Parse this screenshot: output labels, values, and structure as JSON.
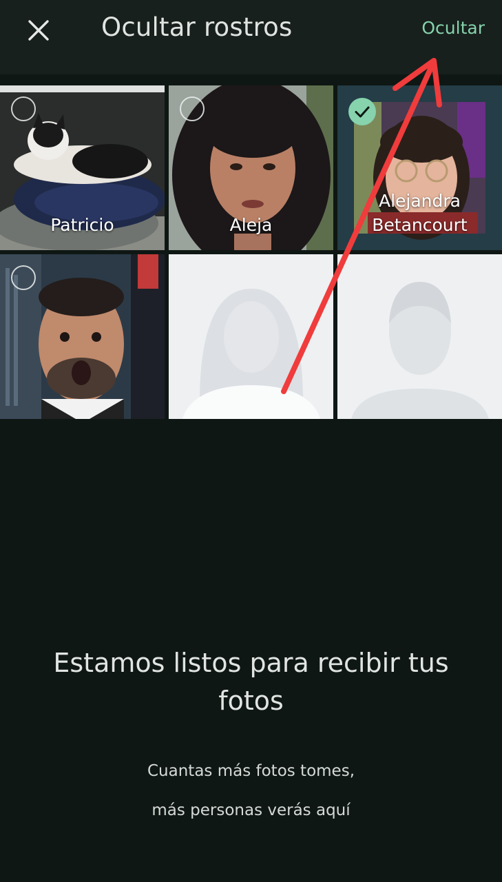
{
  "header": {
    "title": "Ocultar rostros",
    "action_label": "Ocultar",
    "close_icon": "close-icon"
  },
  "faces": [
    {
      "name": "Patricio",
      "selected": false
    },
    {
      "name": "Aleja",
      "selected": false
    },
    {
      "name": "Alejandra Betancourt",
      "selected": true
    },
    {
      "name": "",
      "selected": false
    },
    {
      "name": "",
      "selected": false,
      "placeholder": true
    },
    {
      "name": "",
      "selected": false,
      "placeholder": true
    }
  ],
  "empty_state": {
    "title": "Estamos listos para recibir tus fotos",
    "line1": "Cuantas más fotos tomes,",
    "line2": "más personas verás aquí"
  },
  "colors": {
    "background": "#0f1714",
    "header": "#18201d",
    "accent": "#86d3ad",
    "annotation_arrow": "#f03c3c"
  }
}
